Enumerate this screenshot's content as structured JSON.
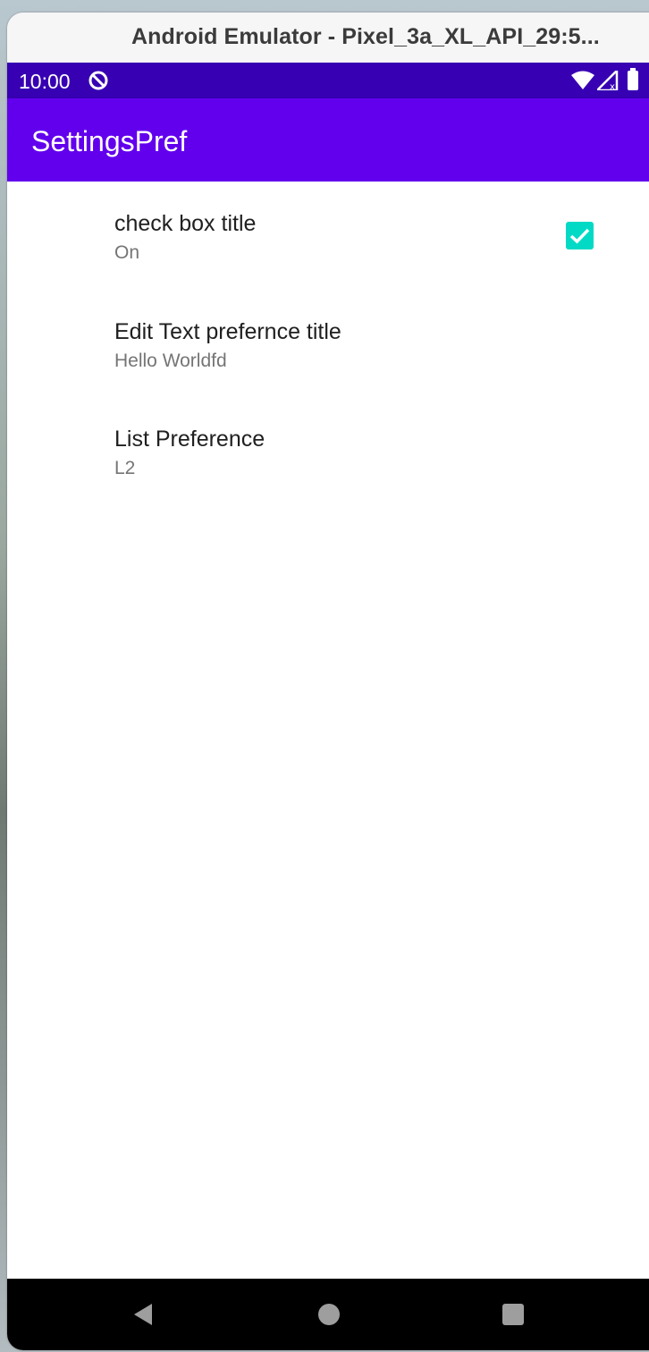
{
  "window": {
    "title": "Android Emulator - Pixel_3a_XL_API_29:5..."
  },
  "status_bar": {
    "time": "10:00"
  },
  "app_bar": {
    "title": "SettingsPref"
  },
  "preferences": [
    {
      "title": "check box title",
      "summary": "On",
      "widget": "checkbox",
      "checked": true
    },
    {
      "title": "Edit Text prefernce title",
      "summary": "Hello Worldfd"
    },
    {
      "title": "List Preference",
      "summary": "L2"
    }
  ],
  "colors": {
    "status_bar": "#3700b3",
    "app_bar": "#6200ee",
    "checkbox": "#03dac5"
  },
  "nav_bar": {
    "icons": [
      "back-icon",
      "home-icon",
      "recents-icon"
    ]
  }
}
